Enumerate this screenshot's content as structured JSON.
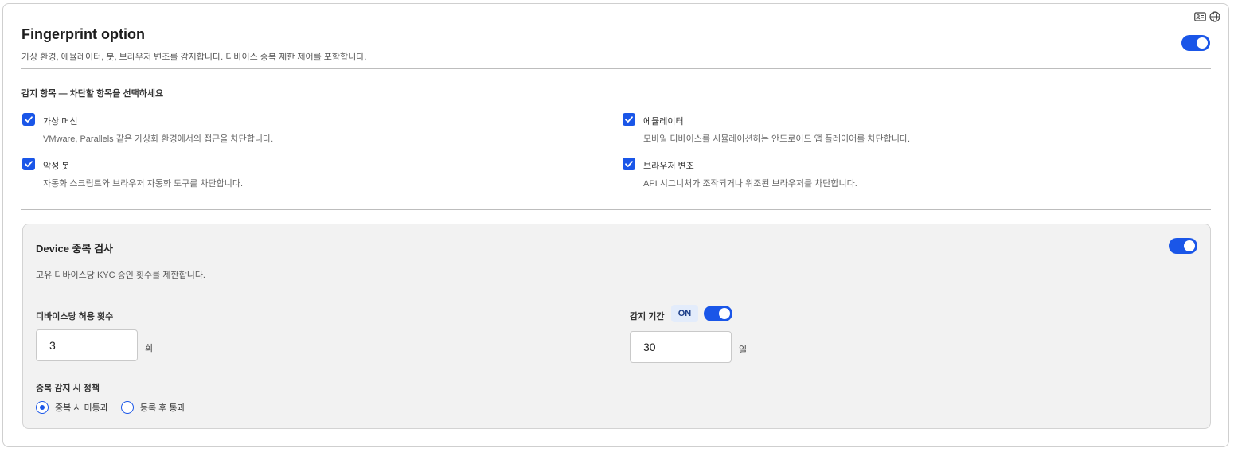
{
  "fingerprint": {
    "title": "Fingerprint option",
    "subtitle": "가상 환경, 에뮬레이터, 봇, 브라우저 변조를 감지합니다. 디바이스 중복 제한 제어를 포함합니다.",
    "enabled": true,
    "detection_label": "감지 항목 — 차단할 항목을 선택하세요",
    "items": [
      {
        "label": "가상 머신",
        "desc": "VMware, Parallels 같은 가상화 환경에서의 접근을 차단합니다.",
        "checked": true
      },
      {
        "label": "에뮬레이터",
        "desc": "모바일 디바이스를 시뮬레이션하는 안드로이드 앱 플레이어를 차단합니다.",
        "checked": true
      },
      {
        "label": "악성 봇",
        "desc": "자동화 스크립트와 브라우저 자동화 도구를 차단합니다.",
        "checked": true
      },
      {
        "label": "브라우저 변조",
        "desc": "API 시그니처가 조작되거나 위조된 브라우저를 차단합니다.",
        "checked": true
      }
    ]
  },
  "device": {
    "title": "Device 중복 검사",
    "desc": "고유 디바이스당 KYC 승인 횟수를 제한합니다.",
    "enabled": true,
    "allow_count_label": "디바이스당 허용 횟수",
    "allow_count_value": "3",
    "allow_count_unit": "회",
    "period_label": "감지 기간",
    "period_badge": "ON",
    "period_enabled": true,
    "period_value": "30",
    "period_unit": "일",
    "policy_label": "중복 감지 시 정책",
    "policy_options": [
      {
        "label": "중복 시 미통과",
        "selected": true
      },
      {
        "label": "등록 후 통과",
        "selected": false
      }
    ]
  },
  "colors": {
    "accent": "#1a56e8",
    "panel_bg": "#f2f2f2",
    "border": "#cfcfcf"
  },
  "icons": [
    "id-card-icon",
    "globe-icon",
    "check-icon"
  ]
}
